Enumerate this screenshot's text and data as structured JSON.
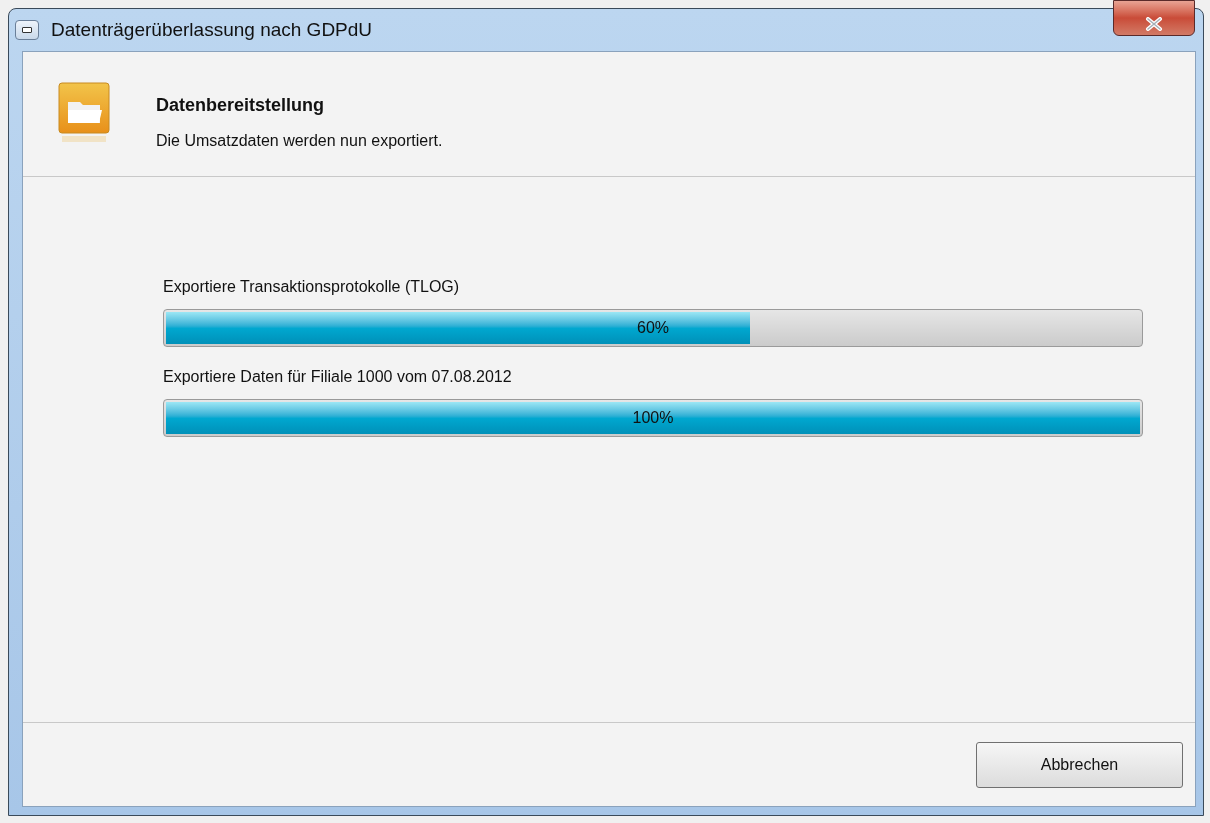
{
  "window": {
    "title": "Datenträgerüberlassung nach GDPdU"
  },
  "header": {
    "title": "Datenbereitstellung",
    "subtitle": "Die Umsatzdaten werden nun exportiert."
  },
  "progress": [
    {
      "label": "Exportiere Transaktionsprotokolle (TLOG)",
      "level": 0.6,
      "reading": "60%"
    },
    {
      "label": "Exportiere Daten für Filiale 1000 vom 07.08.2012",
      "level": 1,
      "reading": "100%"
    }
  ],
  "buttons": [
    "Abbrechen"
  ]
}
